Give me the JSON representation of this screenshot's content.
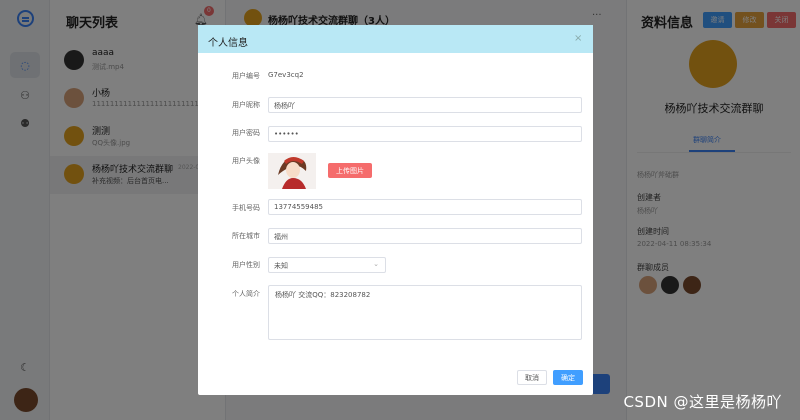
{
  "colors": {
    "accent": "#3b82f6",
    "danger": "#f56c6c",
    "primary": "#409eff",
    "modal_header": "#b9e8f5"
  },
  "chat_list": {
    "title": "聊天列表",
    "badge": "0",
    "items": [
      {
        "name": "aaaa",
        "preview": "测试.mp4",
        "time": ""
      },
      {
        "name": "小杨",
        "preview": "11111111111111111111111111111",
        "time": ""
      },
      {
        "name": "测测",
        "preview": "QQ头像.jpg",
        "time": ""
      },
      {
        "name": "杨杨吖技术交流群聊",
        "preview": "补充视频：后台首页电...",
        "time": "2022-0"
      }
    ]
  },
  "conversation": {
    "title": "杨杨吖技术交流群聊（3人）",
    "more": "···"
  },
  "info_panel": {
    "title": "资料信息",
    "buttons": [
      "邀请",
      "修改",
      "关闭"
    ],
    "group_name": "杨杨吖技术交流群聊",
    "tab": "群聊简介",
    "intro": "杨杨吖斧础群",
    "creator_label": "创建者",
    "creator": "杨杨吖",
    "created_label": "创建时间",
    "created_at": "2022-04-11 08:35:34",
    "members_label": "群聊成员"
  },
  "modal": {
    "title": "个人信息",
    "close": "×",
    "fields": {
      "id_label": "用户编号",
      "id_value": "G7ev3cq2",
      "nick_label": "用户昵称",
      "nick_value": "杨杨吖",
      "pwd_label": "用户密码",
      "pwd_value": "••••••",
      "avatar_label": "用户头像",
      "upload_label": "上传图片",
      "phone_label": "手机号码",
      "phone_value": "13774559485",
      "city_label": "所在城市",
      "city_value": "福州",
      "gender_label": "用户性别",
      "gender_value": "未知",
      "bio_label": "个人简介",
      "bio_value": "杨杨吖 交流QQ：823208782"
    },
    "cancel": "取消",
    "confirm": "确定"
  },
  "watermark": "CSDN @这里是杨杨吖"
}
